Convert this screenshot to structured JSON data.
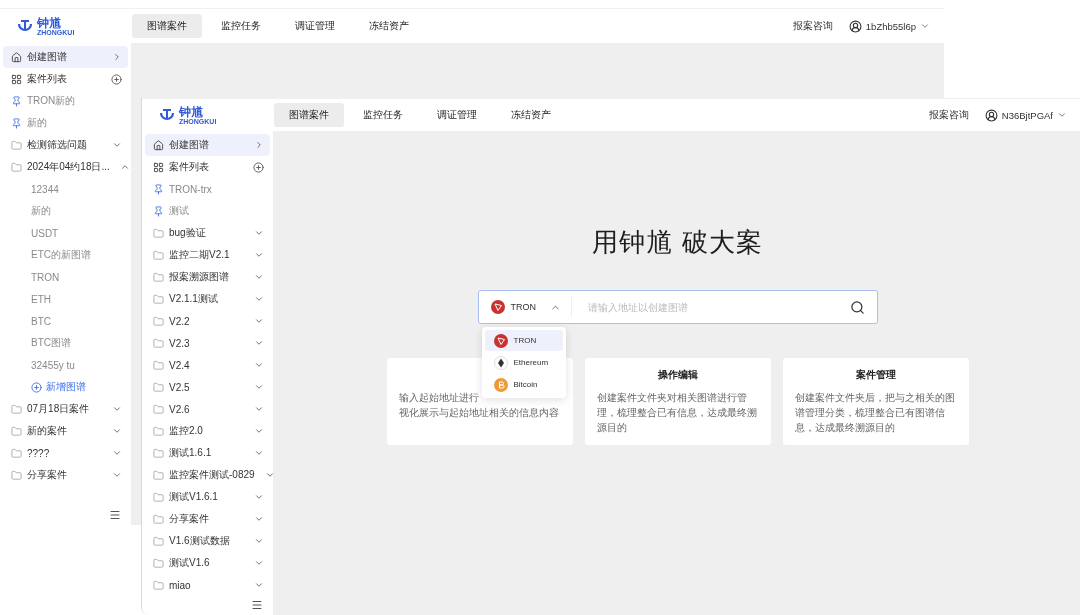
{
  "windows": [
    {
      "logo": {
        "name": "钟馗",
        "subtitle": "ZHONGKUI"
      },
      "tabs": [
        {
          "label": "图谱案件",
          "selected": true
        },
        {
          "label": "监控任务",
          "selected": false
        },
        {
          "label": "调证管理",
          "selected": false
        },
        {
          "label": "冻结资产",
          "selected": false
        }
      ],
      "consult": "报案咨询",
      "user": "1bZhb55l6p",
      "sidebar": [
        {
          "kind": "nav",
          "label": "创建图谱",
          "selected": true
        },
        {
          "kind": "list",
          "label": "案件列表",
          "selected": false
        },
        {
          "kind": "pin",
          "label": "TRON新的",
          "selected": false
        },
        {
          "kind": "pin",
          "label": "新的",
          "selected": false
        },
        {
          "kind": "folder",
          "label": "检测筛选问题",
          "selected": false,
          "expanded": false
        },
        {
          "kind": "folder",
          "label": "2024年04约18日...",
          "selected": false,
          "expanded": true,
          "add_label": "新增图谱",
          "children": [
            {
              "label": "12344",
              "selected": false
            },
            {
              "label": "新的",
              "selected": false
            },
            {
              "label": "USDT",
              "selected": false
            },
            {
              "label": "ETC的新图谱",
              "selected": false
            },
            {
              "label": "TRON",
              "selected": false
            },
            {
              "label": "ETH",
              "selected": false
            },
            {
              "label": "BTC",
              "selected": false
            },
            {
              "label": "BTC图谱",
              "selected": false
            },
            {
              "label": "32455y tu",
              "selected": false
            }
          ]
        },
        {
          "kind": "folder",
          "label": "07月18日案件",
          "selected": false,
          "expanded": false
        },
        {
          "kind": "folder",
          "label": "新的案件",
          "selected": false,
          "expanded": false
        },
        {
          "kind": "folder",
          "label": "????",
          "selected": false,
          "expanded": false
        },
        {
          "kind": "folder",
          "label": "分享案件",
          "selected": false,
          "expanded": false
        }
      ]
    },
    {
      "logo": {
        "name": "钟馗",
        "subtitle": "ZHONGKUI"
      },
      "tabs": [
        {
          "label": "图谱案件",
          "selected": true
        },
        {
          "label": "监控任务",
          "selected": false
        },
        {
          "label": "调证管理",
          "selected": false
        },
        {
          "label": "冻结资产",
          "selected": false
        }
      ],
      "consult": "报案咨询",
      "user": "N36BjtPGAf",
      "sidebar": [
        {
          "kind": "nav",
          "label": "创建图谱",
          "selected": true
        },
        {
          "kind": "list",
          "label": "案件列表",
          "selected": false
        },
        {
          "kind": "pin",
          "label": "TRON-trx",
          "selected": false
        },
        {
          "kind": "pin",
          "label": "测试",
          "selected": false
        },
        {
          "kind": "folder",
          "label": "bug验证",
          "selected": false,
          "expanded": false
        },
        {
          "kind": "folder",
          "label": "监控二期V2.1",
          "selected": false,
          "expanded": false
        },
        {
          "kind": "folder",
          "label": "报案溯源图谱",
          "selected": false,
          "expanded": false
        },
        {
          "kind": "folder",
          "label": "V2.1.1测试",
          "selected": false,
          "expanded": false
        },
        {
          "kind": "folder",
          "label": "V2.2",
          "selected": false,
          "expanded": false
        },
        {
          "kind": "folder",
          "label": "V2.3",
          "selected": false,
          "expanded": false
        },
        {
          "kind": "folder",
          "label": "V2.4",
          "selected": false,
          "expanded": false
        },
        {
          "kind": "folder",
          "label": "V2.5",
          "selected": false,
          "expanded": false
        },
        {
          "kind": "folder",
          "label": "V2.6",
          "selected": false,
          "expanded": false
        },
        {
          "kind": "folder",
          "label": "监控2.0",
          "selected": false,
          "expanded": false
        },
        {
          "kind": "folder",
          "label": "测试1.6.1",
          "selected": false,
          "expanded": false
        },
        {
          "kind": "folder",
          "label": "监控案件测试-0829",
          "selected": false,
          "expanded": false
        },
        {
          "kind": "folder",
          "label": "测试V1.6.1",
          "selected": false,
          "expanded": false
        },
        {
          "kind": "folder",
          "label": "分享案件",
          "selected": false,
          "expanded": false
        },
        {
          "kind": "folder",
          "label": "V1.6测试数据",
          "selected": false,
          "expanded": false
        },
        {
          "kind": "folder",
          "label": "测试V1.6",
          "selected": false,
          "expanded": false
        },
        {
          "kind": "folder",
          "label": "miao",
          "selected": false,
          "expanded": false
        }
      ],
      "main": {
        "title": "用钟馗 破大案",
        "search": {
          "chain": "TRON",
          "placeholder": "请输入地址以创建图谱",
          "open": true
        },
        "chains": [
          {
            "kind": "tron",
            "label": "TRON",
            "selected": true
          },
          {
            "kind": "eth",
            "label": "Ethereum",
            "selected": false
          },
          {
            "kind": "btc",
            "label": "Bitcoin",
            "selected": false
          }
        ],
        "cards": [
          {
            "lines": [
              "输入起始地址进行",
              "视化展示与起始地址相关的信息内容"
            ]
          },
          {
            "title": "操作编辑",
            "lines": [
              "创建案件文件夹对相关图谱进行管理，梳理整合已有信息，达成最终溯源目的"
            ]
          },
          {
            "title": "案件管理",
            "lines": [
              "创建案件文件夹后，把与之相关的图谱管理分类，梳理整合已有图谱信息，达成最终溯源目的"
            ]
          }
        ]
      }
    }
  ]
}
